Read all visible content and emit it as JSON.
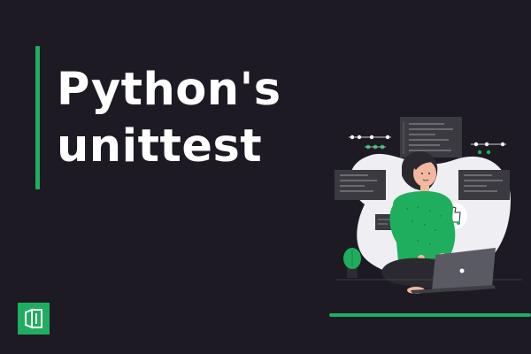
{
  "title": {
    "line1": "Python's",
    "line2": "unittest"
  },
  "colors": {
    "background": "#1d1a24",
    "accent": "#1fae5e",
    "text": "#ffffff"
  },
  "icons": {
    "logo": "brand-logo-icon",
    "illustration": "person-with-laptop-illustration"
  }
}
